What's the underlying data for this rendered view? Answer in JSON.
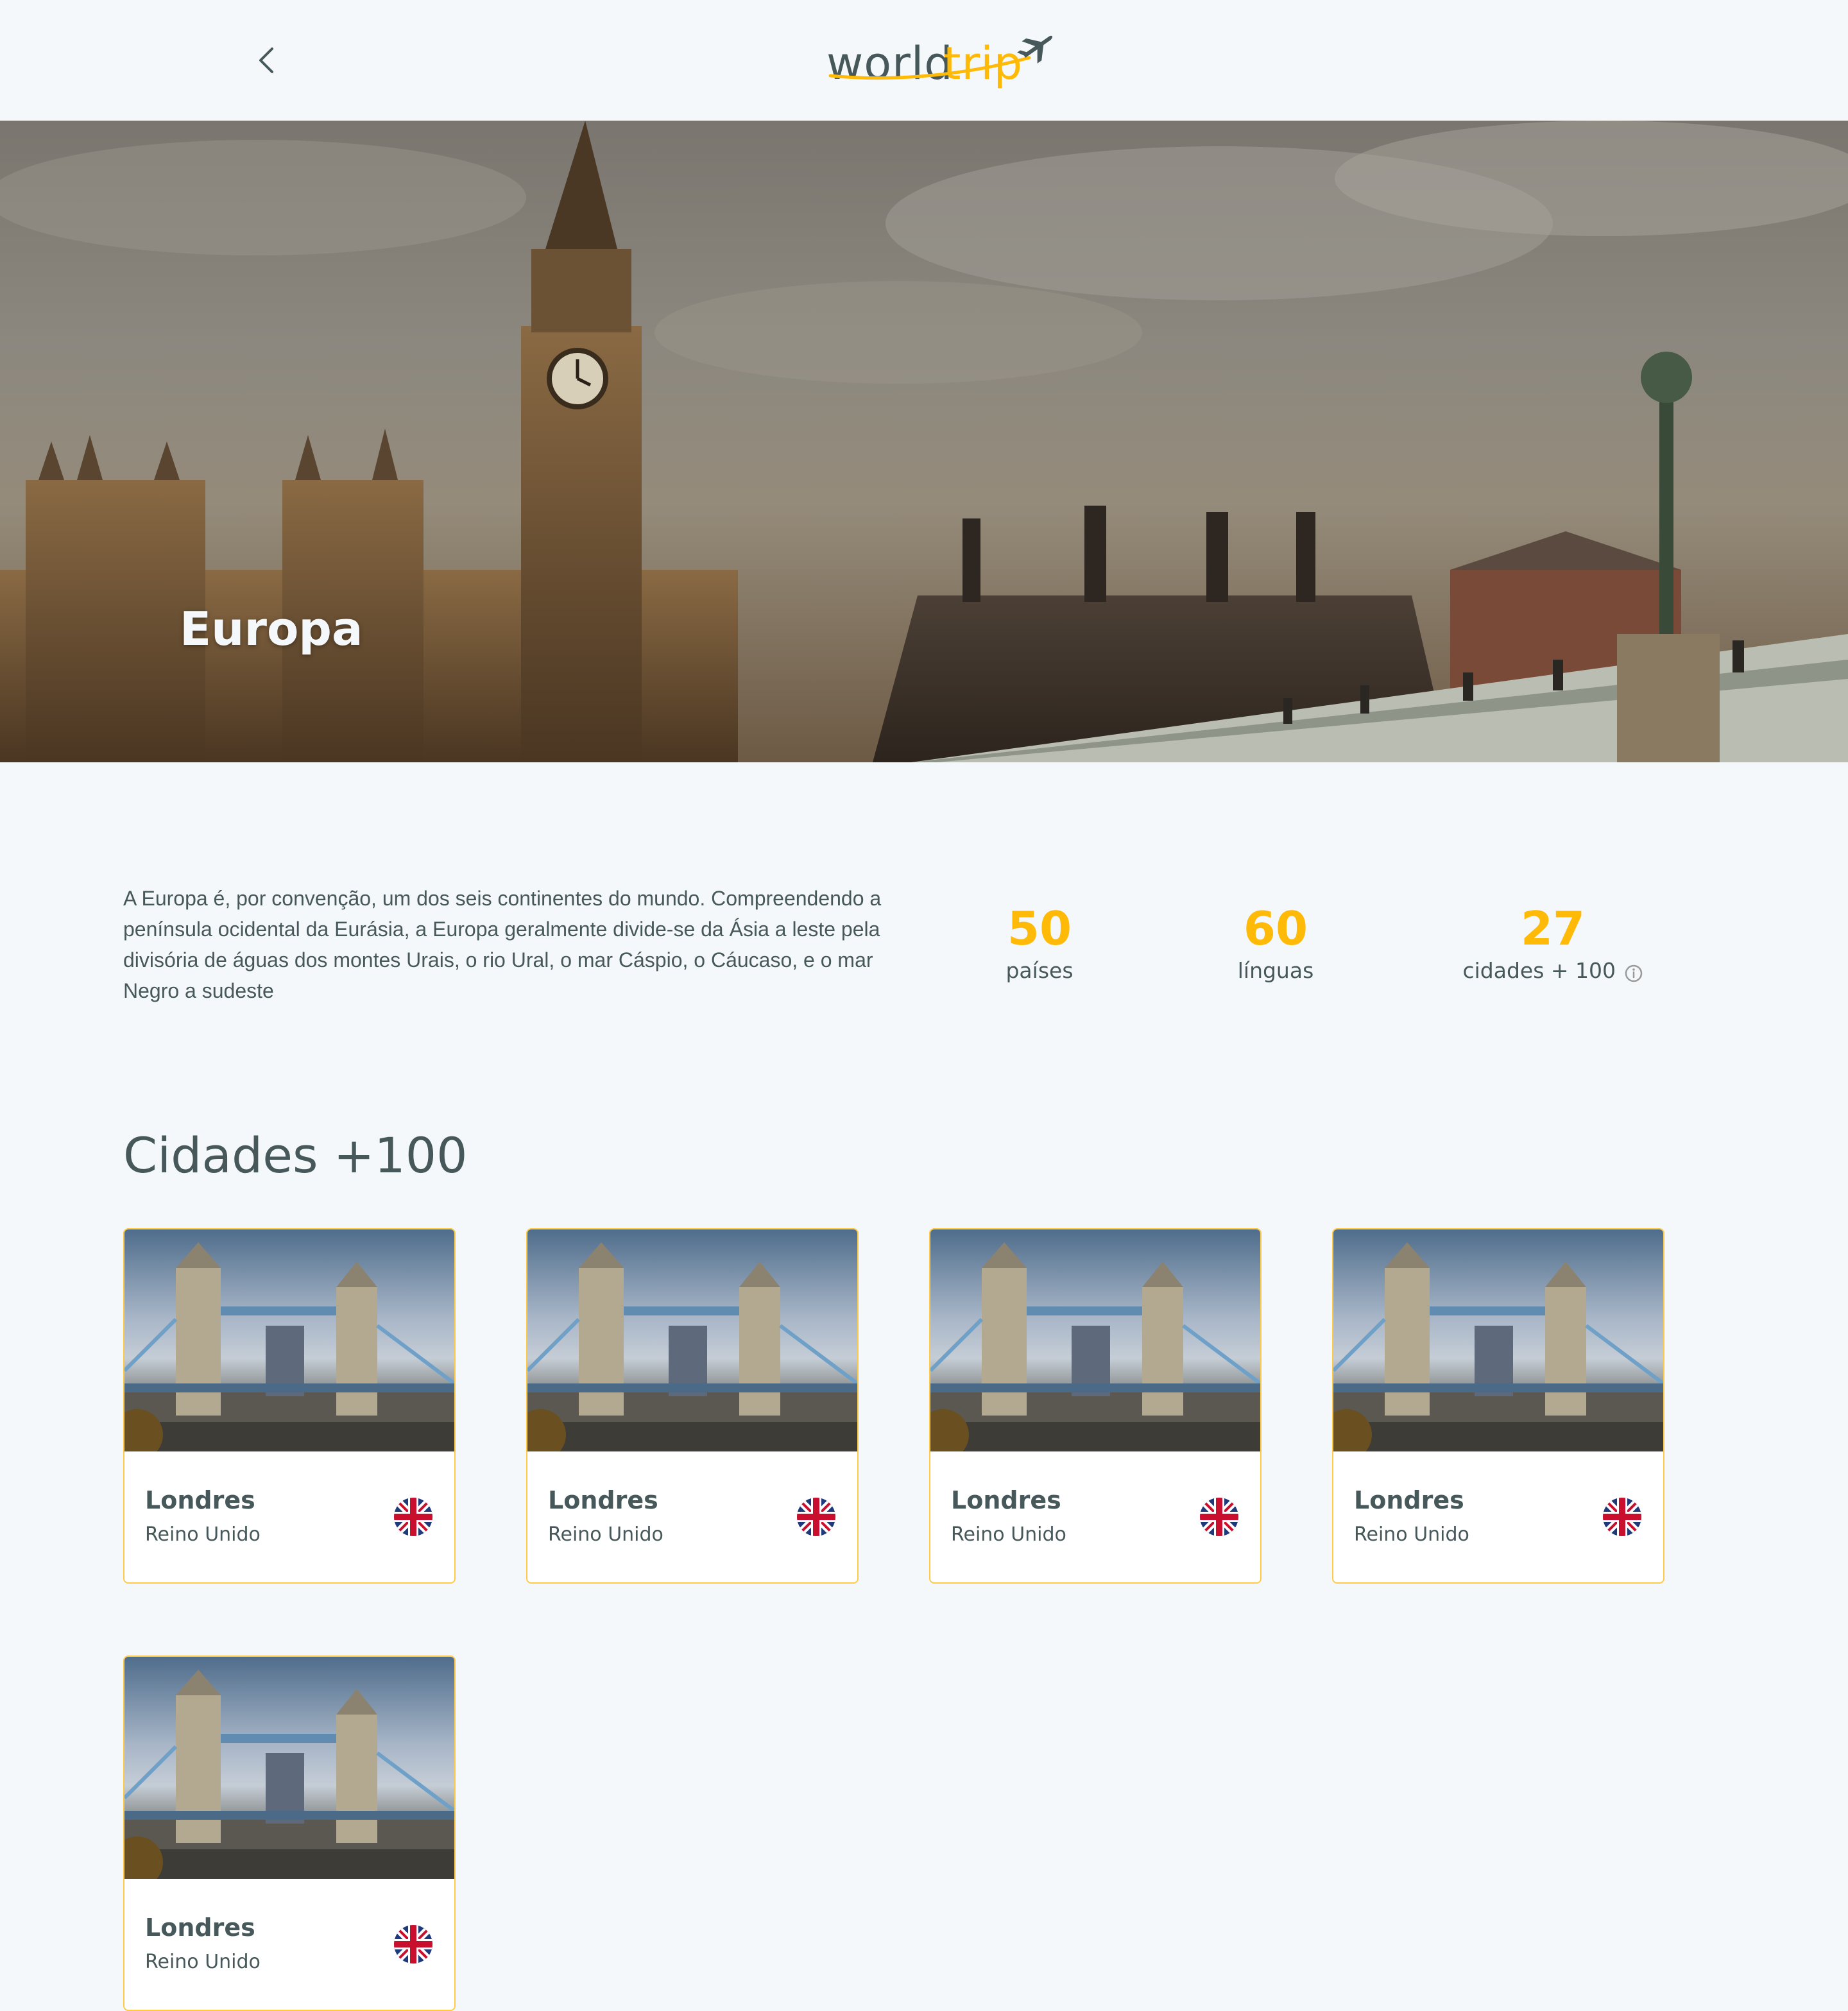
{
  "header": {
    "logo_world": "world",
    "logo_trip": "trip"
  },
  "banner": {
    "title": "Europa"
  },
  "info": {
    "description": "A Europa é, por convenção, um dos seis continentes do mundo. Compreendendo a península ocidental da Eurásia, a Europa geralmente divide-se da Ásia a leste pela divisória de águas dos montes Urais, o rio Ural, o mar Cáspio, o Cáucaso, e o mar Negro a sudeste",
    "stats": [
      {
        "value": "50",
        "label": "países"
      },
      {
        "value": "60",
        "label": "línguas"
      },
      {
        "value": "27",
        "label": "cidades + 100"
      }
    ]
  },
  "cities": {
    "title": "Cidades +100",
    "items": [
      {
        "name": "Londres",
        "country": "Reino Unido"
      },
      {
        "name": "Londres",
        "country": "Reino Unido"
      },
      {
        "name": "Londres",
        "country": "Reino Unido"
      },
      {
        "name": "Londres",
        "country": "Reino Unido"
      },
      {
        "name": "Londres",
        "country": "Reino Unido"
      }
    ]
  },
  "colors": {
    "accent": "#ffba08",
    "text": "#47585b",
    "background": "#f5f8fa"
  },
  "icons": {
    "back": "chevron-left-icon",
    "info": "info-circle-icon",
    "flag": "uk-flag-icon",
    "airplane": "airplane-icon"
  }
}
